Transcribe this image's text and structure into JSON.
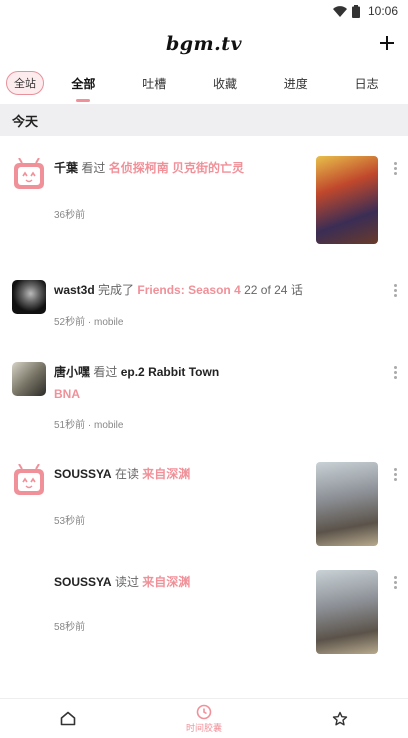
{
  "status_bar": {
    "time": "10:06"
  },
  "app_bar": {
    "logo": "bgm.tv",
    "add_icon": "plus-icon"
  },
  "tabs": {
    "scope_label": "全站",
    "items": [
      {
        "label": "全部",
        "active": true
      },
      {
        "label": "吐槽",
        "active": false
      },
      {
        "label": "收藏",
        "active": false
      },
      {
        "label": "进度",
        "active": false
      },
      {
        "label": "日志",
        "active": false
      }
    ]
  },
  "section": {
    "title": "今天"
  },
  "feed": [
    {
      "user": "千葉",
      "verb": "看过",
      "subject": "名侦探柯南 贝克街的亡灵",
      "time": "36秒前"
    },
    {
      "user": "wast3d",
      "verb": "完成了",
      "subject": "Friends: Season 4",
      "progress": "22 of 24 话",
      "time": "52秒前 · mobile"
    },
    {
      "user": "唐小嘿",
      "verb": "看过",
      "episode": "ep.2 Rabbit Town",
      "subject": "BNA",
      "time": "51秒前 · mobile"
    },
    {
      "user": "SOUSSYA",
      "verb": "在读",
      "subject": "来自深渊",
      "time": "53秒前"
    },
    {
      "user": "SOUSSYA",
      "verb": "读过",
      "subject": "来自深渊",
      "time": "58秒前"
    }
  ],
  "bottom_nav": [
    {
      "icon": "home-icon",
      "label": ""
    },
    {
      "icon": "clock-icon",
      "label": "时间胶囊"
    },
    {
      "icon": "star-icon",
      "label": ""
    }
  ],
  "colors": {
    "accent": "#f09199",
    "section_bg": "#efeff1"
  }
}
